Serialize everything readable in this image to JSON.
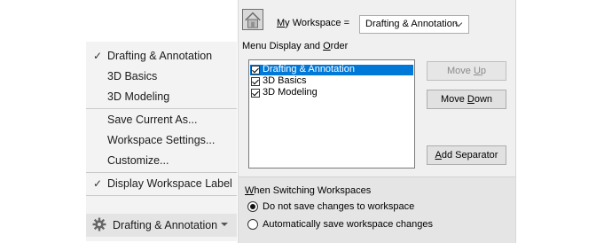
{
  "menu": {
    "items": [
      {
        "label": "Drafting & Annotation",
        "checked": true
      },
      {
        "label": "3D Basics",
        "checked": false
      },
      {
        "label": "3D Modeling",
        "checked": false
      },
      {
        "label": "Save Current As...",
        "checked": false
      },
      {
        "label": "Workspace Settings...",
        "checked": false
      },
      {
        "label": "Customize...",
        "checked": false
      },
      {
        "label": "Display Workspace Label",
        "checked": true
      }
    ],
    "check_mark": "✓",
    "current_workspace": "Drafting & Annotation",
    "current_icon": "gear-icon"
  },
  "dialog": {
    "my_workspace_prefix": "",
    "my_workspace_key": "M",
    "my_workspace_rest": "y Workspace =",
    "workspace_selected": "Drafting & Annotation",
    "menu_group_label_pre": "Menu Display and ",
    "menu_group_label_key": "O",
    "menu_group_label_post": "rder",
    "list": [
      {
        "label": "Drafting & Annotation",
        "checked": true,
        "selected": true
      },
      {
        "label": "3D Basics",
        "checked": true,
        "selected": false
      },
      {
        "label": "3D Modeling",
        "checked": true,
        "selected": false
      }
    ],
    "buttons": {
      "move_up_pre": "Move ",
      "move_up_key": "U",
      "move_up_post": "p",
      "move_down_pre": "Move ",
      "move_down_key": "D",
      "move_down_post": "own",
      "add_sep_key": "A",
      "add_sep_post": "dd Separator"
    },
    "switching": {
      "title_key": "W",
      "title_post": "hen Switching Workspaces",
      "options": [
        {
          "label": "Do not save changes to workspace",
          "selected": true
        },
        {
          "label": "Automatically save workspace changes",
          "selected": false
        }
      ]
    }
  }
}
